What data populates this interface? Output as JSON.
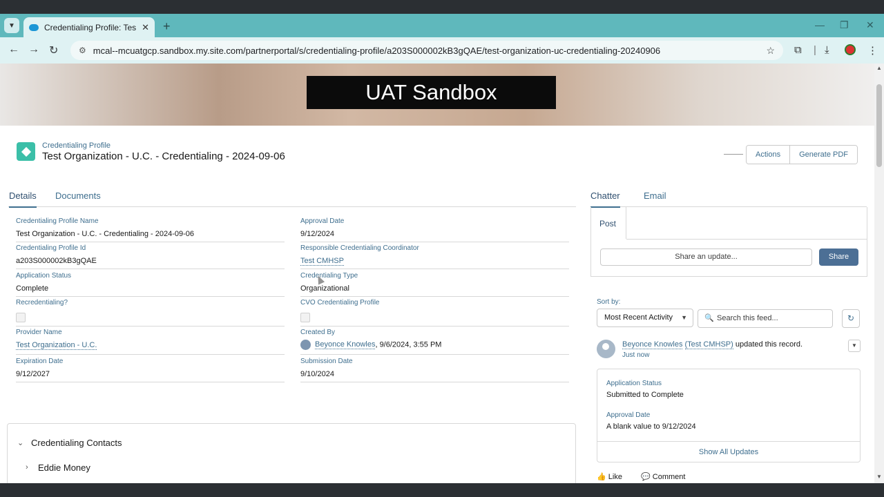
{
  "browser": {
    "tab_title": "Credentialing Profile: Test Orga",
    "tab_close": "✕",
    "new_tab": "+",
    "url": "mcal--mcuatgcp.sandbox.my.site.com/partnerportal/s/credentialing-profile/a203S000002kB3gQAE/test-organization-uc-credentialing-20240906",
    "icons": [
      "tab-list-icon",
      "back-icon",
      "forward-icon",
      "reload-icon",
      "site-info-icon",
      "bookmark-star-icon",
      "extensions-icon",
      "download-icon",
      "profile-icon",
      "menu-icon"
    ]
  },
  "banner": {
    "text": "UAT Sandbox"
  },
  "record": {
    "type": "Credentialing Profile",
    "title": "Test Organization - U.C. - Credentialing - 2024-09-06",
    "actions_label": "Actions",
    "generate_pdf_label": "Generate PDF"
  },
  "left_tabs": {
    "details": "Details",
    "documents": "Documents"
  },
  "fields": {
    "profile_name": {
      "label": "Credentialing Profile Name",
      "value": "Test Organization - U.C. - Credentialing - 2024-09-06"
    },
    "approval_date": {
      "label": "Approval Date",
      "value": "9/12/2024"
    },
    "profile_id": {
      "label": "Credentialing Profile Id",
      "value": "a203S000002kB3gQAE"
    },
    "coordinator": {
      "label": "Responsible Credentialing Coordinator",
      "value": "Test CMHSP"
    },
    "app_status": {
      "label": "Application Status",
      "value": "Complete"
    },
    "cred_type": {
      "label": "Credentialing Type",
      "value": "Organizational"
    },
    "recred": {
      "label": "Recredentialing?"
    },
    "cvo": {
      "label": "CVO Credentialing Profile"
    },
    "provider": {
      "label": "Provider Name",
      "value": "Test Organization - U.C."
    },
    "created_by": {
      "label": "Created By",
      "name": "Beyonce Knowles",
      "date": ", 9/6/2024, 3:55 PM"
    },
    "expiration": {
      "label": "Expiration Date",
      "value": "9/12/2027"
    },
    "submission": {
      "label": "Submission Date",
      "value": "9/10/2024"
    }
  },
  "contacts": {
    "section_title": "Credentialing Contacts",
    "first_contact": "Eddie Money"
  },
  "right_tabs": {
    "chatter": "Chatter",
    "email": "Email"
  },
  "publisher": {
    "post_tab": "Post",
    "placeholder": "Share an update...",
    "share_label": "Share"
  },
  "feed": {
    "sort_label": "Sort by:",
    "sort_value": "Most Recent Activity",
    "search_placeholder": "Search this feed...",
    "author": "Beyonce Knowles",
    "author_org": "(Test CMHSP)",
    "action_text": " updated this record.",
    "time": "Just now",
    "changes": [
      {
        "field": "Application Status",
        "change": "Submitted to Complete"
      },
      {
        "field": "Approval Date",
        "change": "A blank value to 9/12/2024"
      }
    ],
    "show_all": "Show All Updates",
    "like": "Like",
    "comment": "Comment"
  },
  "colors": {
    "accent": "#3e6e8e",
    "share_button": "#4c6f95",
    "record_icon": "#3bbfa8",
    "browser_tab_bar": "#5fb8bc"
  }
}
